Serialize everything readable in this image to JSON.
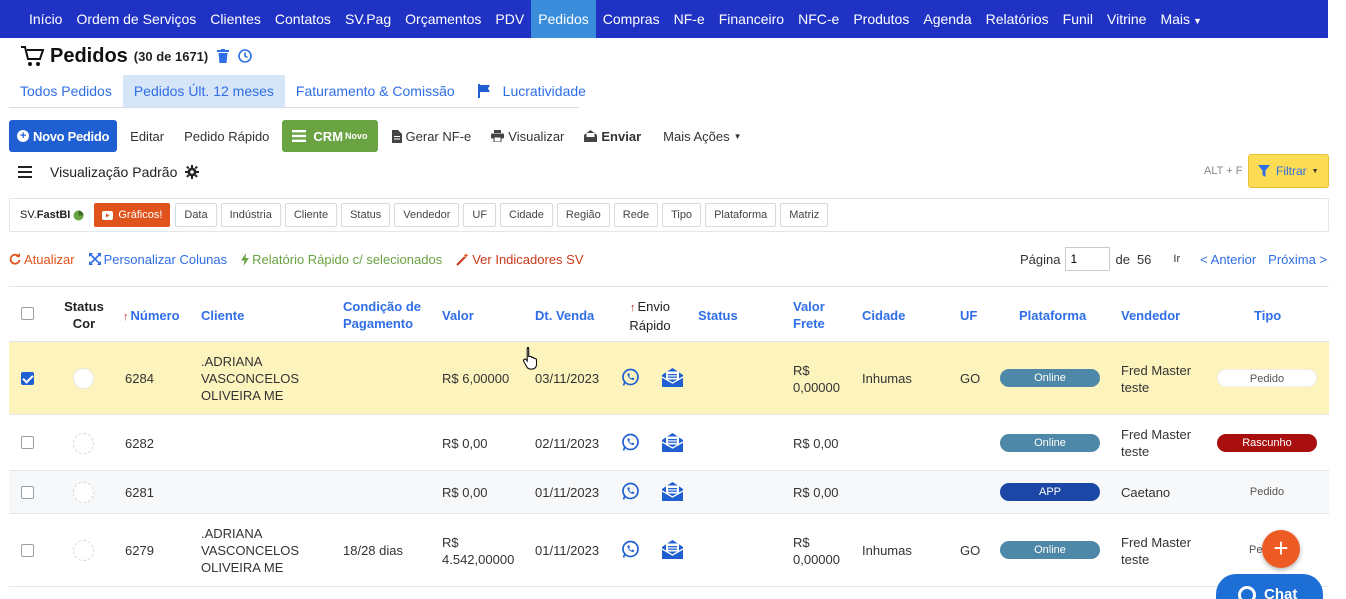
{
  "nav": {
    "items": [
      "Início",
      "Ordem de Serviços",
      "Clientes",
      "Contatos",
      "SV.Pag",
      "Orçamentos",
      "PDV",
      "Pedidos",
      "Compras",
      "NF-e",
      "Financeiro",
      "NFC-e",
      "Produtos",
      "Agenda",
      "Relatórios",
      "Funil",
      "Vitrine",
      "Mais"
    ],
    "active": "Pedidos"
  },
  "header": {
    "title": "Pedidos",
    "count": "(30 de 1671)"
  },
  "tabs": [
    "Todos Pedidos",
    "Pedidos Últ. 12 meses",
    "Faturamento & Comissão",
    "Lucratividade"
  ],
  "toolbar": {
    "new_order": "Novo Pedido",
    "edit": "Editar",
    "quick_order": "Pedido Rápido",
    "crm": "CRM",
    "crm_badge": "Novo",
    "nfe": "Gerar NF-e",
    "view": "Visualizar",
    "send": "Enviar",
    "more": "Mais Ações"
  },
  "view": {
    "label": "Visualização Padrão",
    "shortcut": "ALT + F",
    "filter": "Filtrar"
  },
  "chips": {
    "brand_prefix": "SV.",
    "brand": "FastBI",
    "charts": "Gráficos!",
    "items": [
      "Data",
      "Indústria",
      "Cliente",
      "Status",
      "Vendedor",
      "UF",
      "Cidade",
      "Região",
      "Rede",
      "Tipo",
      "Plataforma",
      "Matriz"
    ]
  },
  "links": {
    "refresh": "Atualizar",
    "columns": "Personalizar Colunas",
    "report": "Relatório Rápido c/ selecionados",
    "indicators": "Ver Indicadores SV"
  },
  "pager": {
    "label": "Página",
    "value": "1",
    "of": "de",
    "total": "56",
    "go": "Ir",
    "prev": "< Anterior",
    "next": "Próxima >"
  },
  "table": {
    "headers": {
      "status_cor_1": "Status",
      "status_cor_2": "Cor",
      "numero": "Número",
      "cliente": "Cliente",
      "condicao_1": "Condição de",
      "condicao_2": "Pagamento",
      "valor": "Valor",
      "dt_venda": "Dt. Venda",
      "envio_1": "Envio",
      "envio_2": "Rápido",
      "status": "Status",
      "frete_1": "Valor",
      "frete_2": "Frete",
      "cidade": "Cidade",
      "uf": "UF",
      "plataforma": "Plataforma",
      "vendedor": "Vendedor",
      "tipo": "Tipo"
    },
    "rows": [
      {
        "numero": "6284",
        "cliente_l1": ".ADRIANA",
        "cliente_l2": "VASCONCELOS",
        "cliente_l3": "OLIVEIRA ME",
        "condicao": "",
        "valor_l1": "R$ 6,00000",
        "valor_l2": "",
        "dt": "03/11/2023",
        "frete_l1": "R$",
        "frete_l2": "0,00000",
        "cidade": "Inhumas",
        "uf": "GO",
        "plataforma": "Online",
        "vendedor_l1": "Fred Master",
        "vendedor_l2": "teste",
        "tipo": "Pedido"
      },
      {
        "numero": "6282",
        "cliente_l1": "",
        "cliente_l2": "",
        "cliente_l3": "",
        "condicao": "",
        "valor_l1": "R$ 0,00",
        "valor_l2": "",
        "dt": "02/11/2023",
        "frete_l1": "R$ 0,00",
        "frete_l2": "",
        "cidade": "",
        "uf": "",
        "plataforma": "Online",
        "vendedor_l1": "Fred Master",
        "vendedor_l2": "teste",
        "tipo": "Rascunho"
      },
      {
        "numero": "6281",
        "cliente_l1": "",
        "cliente_l2": "",
        "cliente_l3": "",
        "condicao": "",
        "valor_l1": "R$ 0,00",
        "valor_l2": "",
        "dt": "01/11/2023",
        "frete_l1": "R$ 0,00",
        "frete_l2": "",
        "cidade": "",
        "uf": "",
        "plataforma": "APP",
        "vendedor_l1": "Caetano",
        "vendedor_l2": "",
        "tipo": "Pedido"
      },
      {
        "numero": "6279",
        "cliente_l1": ".ADRIANA",
        "cliente_l2": "VASCONCELOS",
        "cliente_l3": "OLIVEIRA ME",
        "condicao": "18/28 dias",
        "valor_l1": "R$",
        "valor_l2": "4.542,00000",
        "dt": "01/11/2023",
        "frete_l1": "R$",
        "frete_l2": "0,00000",
        "cidade": "Inhumas",
        "uf": "GO",
        "plataforma": "Online",
        "vendedor_l1": "Fred Master",
        "vendedor_l2": "teste",
        "tipo": "Pe"
      }
    ]
  },
  "chat": {
    "label": "Chat"
  },
  "fab": {
    "label": "+"
  }
}
